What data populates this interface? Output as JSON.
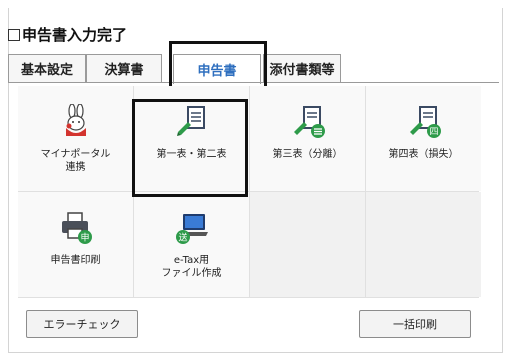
{
  "header": {
    "title": "申告書入力完了"
  },
  "tabs": [
    {
      "label": "基本設定"
    },
    {
      "label": "決算書"
    },
    {
      "label": "申告書"
    },
    {
      "label": "添付書類等"
    }
  ],
  "tiles": [
    {
      "label": "マイナポータル\n連携",
      "icon": "mynaportal-rabbit-icon"
    },
    {
      "label": "第一表・第二表",
      "icon": "edit-document-icon"
    },
    {
      "label": "第三表（分離）",
      "icon": "edit-document-separate-icon"
    },
    {
      "label": "第四表（損失）",
      "icon": "edit-document-loss-icon",
      "badge": "四"
    },
    {
      "label": "申告書印刷",
      "icon": "printer-icon",
      "badge": "申"
    },
    {
      "label": "e-Tax用\nファイル作成",
      "icon": "laptop-send-icon",
      "badge": "送"
    }
  ],
  "footer": {
    "error_check": "エラーチェック",
    "batch_print": "一括印刷"
  },
  "colors": {
    "active_tab_text": "#2f6fbf",
    "badge_green": "#2e9b4a"
  }
}
